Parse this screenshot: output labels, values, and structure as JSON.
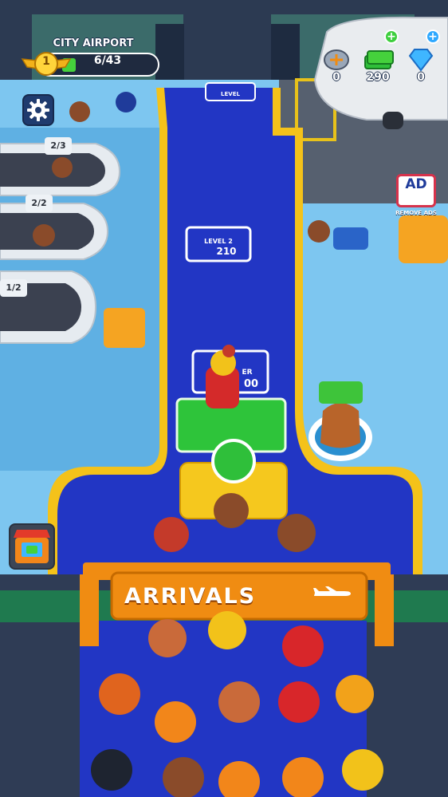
{
  "airport": {
    "name": "CITY AIRPORT",
    "level": "1",
    "progress_text": "6/43",
    "progress_fraction": 0.14
  },
  "currencies": [
    {
      "name": "tickets",
      "icon": "plane-ticket-icon",
      "value": "0"
    },
    {
      "name": "cash",
      "icon": "cash-stack-icon",
      "value": "290"
    },
    {
      "name": "gems",
      "icon": "diamond-icon",
      "value": "0"
    }
  ],
  "remove_ads": {
    "badge": "AD",
    "label": "REMOVE ADS"
  },
  "floor": {
    "locked_level_label": "LEVEL",
    "upgrade_tile": {
      "line1": "LEVEL 2",
      "cost": "210"
    },
    "partial_tile": {
      "line1": "ER",
      "cost": "00"
    },
    "counter_badges": [
      "2/3",
      "2/2",
      "1/2"
    ]
  },
  "arrivals_sign": "ARRIVALS",
  "colors": {
    "carpet": "#2236c4",
    "carpet_edge": "#f4c21a",
    "floor": "#7dc6f0",
    "accent_green": "#3ecf3e",
    "sign_orange": "#f08c12"
  }
}
